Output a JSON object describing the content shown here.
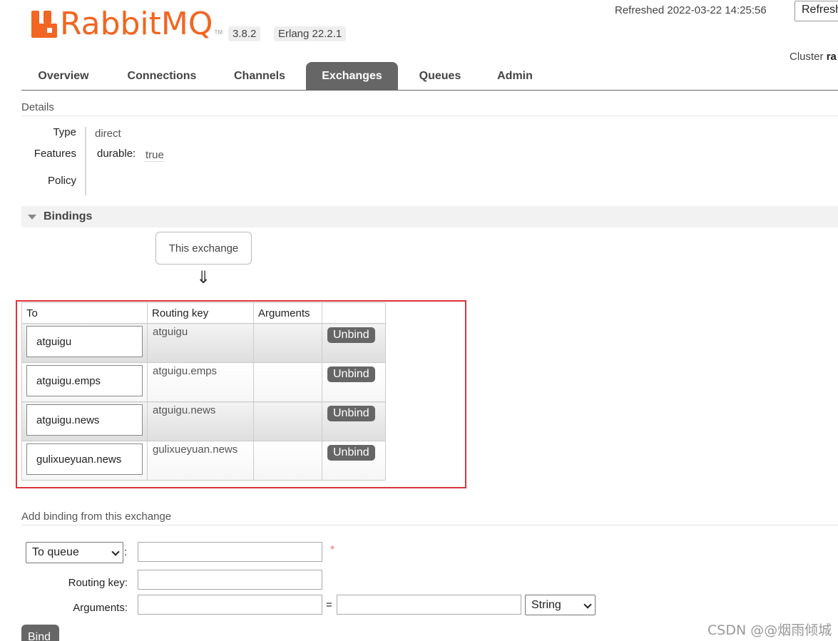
{
  "header": {
    "brand": "RabbitMQ",
    "tm": "TM",
    "version": "3.8.2",
    "erlang": "Erlang 22.2.1",
    "refreshed": "Refreshed 2022-03-22 14:25:56",
    "refresh_button": "Refresh",
    "cluster_label": "Cluster",
    "cluster_value": "ra",
    "brand_color": "#f26522"
  },
  "tabs": [
    {
      "label": "Overview",
      "active": false
    },
    {
      "label": "Connections",
      "active": false
    },
    {
      "label": "Channels",
      "active": false
    },
    {
      "label": "Exchanges",
      "active": true
    },
    {
      "label": "Queues",
      "active": false
    },
    {
      "label": "Admin",
      "active": false
    }
  ],
  "details": {
    "title": "Details",
    "type_label": "Type",
    "type_value": "direct",
    "features_label": "Features",
    "feature_key": "durable:",
    "feature_value": "true",
    "policy_label": "Policy"
  },
  "bindings": {
    "title": "Bindings",
    "this_exchange": "This exchange",
    "arrow": "⇓",
    "columns": [
      "To",
      "Routing key",
      "Arguments",
      ""
    ],
    "rows": [
      {
        "to": "atguigu",
        "routing_key": "atguigu",
        "arguments": "",
        "action": "Unbind"
      },
      {
        "to": "atguigu.emps",
        "routing_key": "atguigu.emps",
        "arguments": "",
        "action": "Unbind"
      },
      {
        "to": "atguigu.news",
        "routing_key": "atguigu.news",
        "arguments": "",
        "action": "Unbind"
      },
      {
        "to": "gulixueyuan.news",
        "routing_key": "gulixueyuan.news",
        "arguments": "",
        "action": "Unbind"
      }
    ]
  },
  "add_binding": {
    "title": "Add binding from this exchange",
    "destination_type": "To queue",
    "colon": ":",
    "required_mark": "*",
    "routing_key_label": "Routing key:",
    "arguments_label": "Arguments:",
    "equals": "=",
    "arg_type": "String",
    "bind_button": "Bind"
  },
  "watermark": "CSDN @@烟雨倾城"
}
